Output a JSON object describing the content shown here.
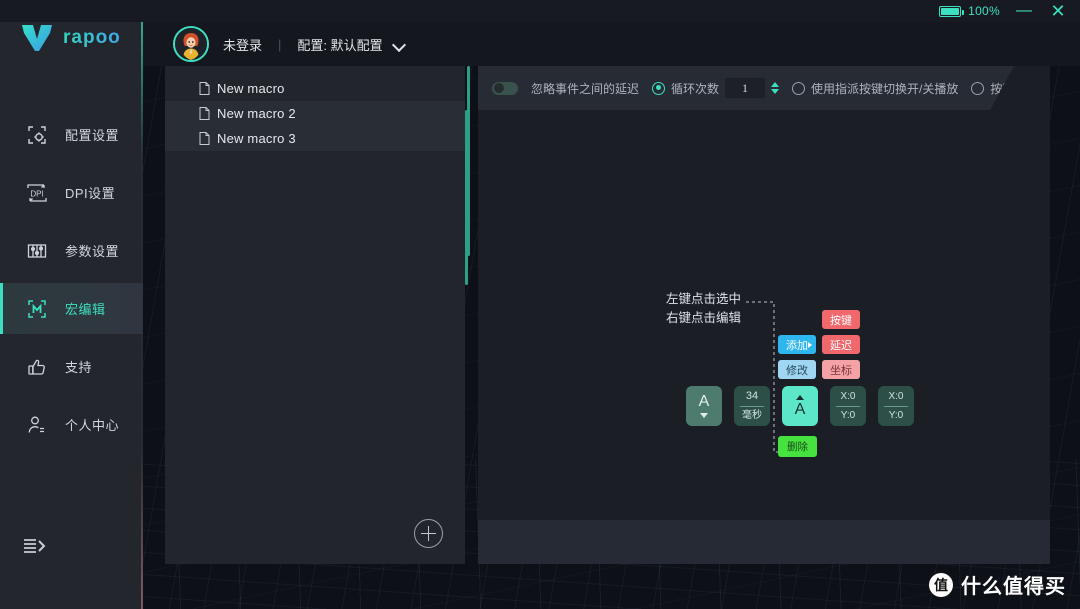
{
  "titlebar": {
    "battery_percent": "100%",
    "battery_icon": "battery-full-icon",
    "minimize_label": "—",
    "close_label": "✕",
    "accent_color": "#3ce0c0"
  },
  "sidebar": {
    "brand": "rapoo",
    "brand_icon": "rapoo-v-logo",
    "collapse_icon": "expand-sidebar-icon",
    "items": [
      {
        "label": "配置设置",
        "icon": "config-settings-icon",
        "active": false
      },
      {
        "label": "DPI设置",
        "icon": "dpi-settings-icon",
        "active": false
      },
      {
        "label": "参数设置",
        "icon": "parameter-settings-icon",
        "active": false
      },
      {
        "label": "宏编辑",
        "icon": "macro-edit-icon",
        "active": true
      },
      {
        "label": "支持",
        "icon": "thumbs-up-icon",
        "active": false
      },
      {
        "label": "个人中心",
        "icon": "user-account-icon",
        "active": false
      }
    ]
  },
  "header": {
    "avatar_icon": "user-avatar",
    "login_status": "未登录",
    "separator": "|",
    "profile_label": "配置: 默认配置",
    "dropdown_icon": "chevron-down-icon"
  },
  "macro_panel": {
    "add_icon": "plus-circle-icon",
    "items": [
      {
        "name": "New macro",
        "icon": "document-icon"
      },
      {
        "name": "New macro 2",
        "icon": "document-icon"
      },
      {
        "name": "New macro 3",
        "icon": "document-icon"
      }
    ]
  },
  "toolbar": {
    "ignore_delay_label": "忽略事件之间的延迟",
    "ignore_delay_on": false,
    "loop_count_label": "循环次数",
    "loop_count_value": "1",
    "loop_count_selected": true,
    "toggle_playback_label": "使用指派按键切换开/关播放",
    "toggle_playback_selected": false,
    "hold_playback_label": "按下时播放",
    "hold_playback_selected": false,
    "spinner_up_icon": "spinner-up-icon",
    "spinner_down_icon": "spinner-down-icon"
  },
  "canvas": {
    "hint_line1": "左键点击选中",
    "hint_line2": "右键点击编辑",
    "context_menu": [
      {
        "label": "添加",
        "style": "blue",
        "has_arrow": true
      },
      {
        "label": "按键",
        "style": "red",
        "has_arrow": false
      },
      {
        "label": "延迟",
        "style": "red",
        "has_arrow": false
      },
      {
        "label": "修改",
        "style": "blue2",
        "has_arrow": false
      },
      {
        "label": "坐标",
        "style": "pink",
        "has_arrow": false
      }
    ],
    "menu_rows": [
      {
        "left": "按键",
        "left_style": "red"
      },
      {
        "left": "添加",
        "left_style": "blue",
        "right": "延迟",
        "right_style": "red"
      },
      {
        "left": "修改",
        "left_style": "blue2",
        "right": "坐标",
        "right_style": "pink"
      }
    ],
    "events": [
      {
        "type": "key-down",
        "glyph": "A",
        "arrow": "down",
        "selected": false
      },
      {
        "type": "delay",
        "value": "34",
        "unit": "毫秒",
        "selected": false
      },
      {
        "type": "key-up",
        "glyph": "A",
        "arrow": "up",
        "selected": true
      },
      {
        "type": "coordinate",
        "x": "X:0",
        "y": "Y:0",
        "selected": false
      },
      {
        "type": "coordinate",
        "x": "X:0",
        "y": "Y:0",
        "selected": false
      }
    ],
    "delete_label": "删除"
  },
  "watermark": {
    "logo_char": "值",
    "text": "什么值得买"
  }
}
